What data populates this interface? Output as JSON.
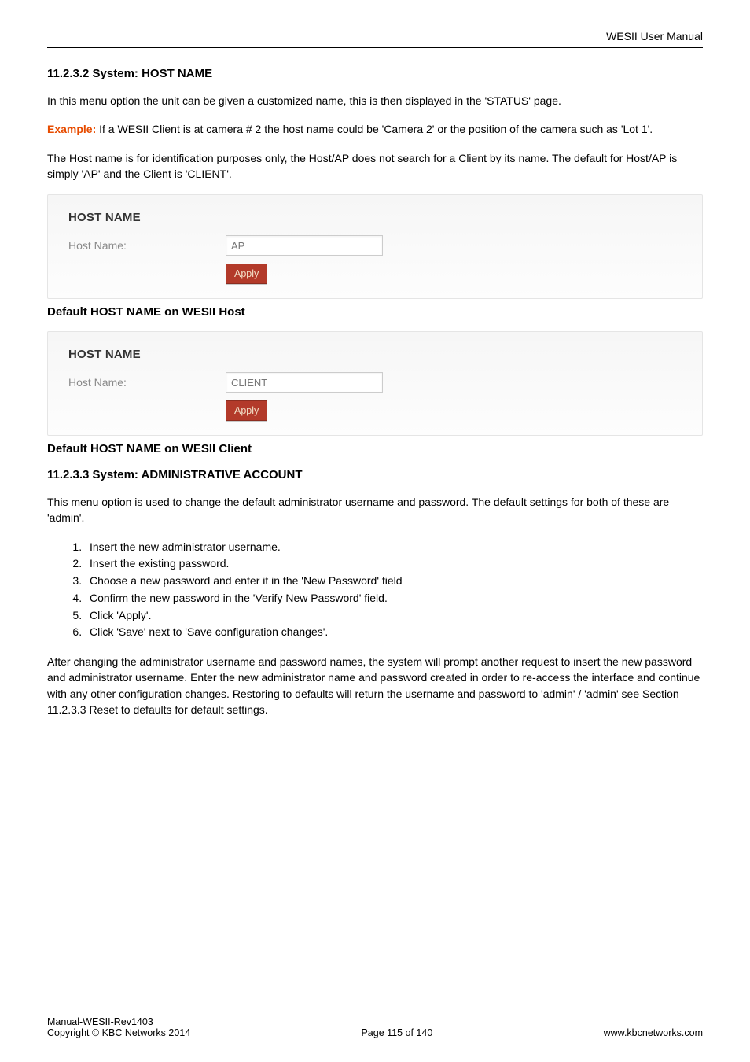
{
  "header": {
    "right": "WESII User Manual"
  },
  "s1": {
    "heading": "11.2.3.2 System: HOST NAME",
    "p1": "In this menu option the unit can be given a customized name, this is then displayed in the 'STATUS' page.",
    "example_label": "Example:",
    "example_text": " If a WESII Client is at camera # 2 the host name could be 'Camera 2' or the position of the camera such as 'Lot 1'.",
    "p3": "The Host name is for identification purposes only, the Host/AP does not search for a Client by its name. The default for Host/AP is simply 'AP' and the Client is 'CLIENT'."
  },
  "shot1": {
    "title": "HOST NAME",
    "label": "Host Name:",
    "value": "AP",
    "button": "Apply",
    "caption": "Default HOST NAME on WESII Host"
  },
  "shot2": {
    "title": "HOST NAME",
    "label": "Host Name:",
    "value": "CLIENT",
    "button": "Apply",
    "caption": "Default HOST NAME on WESII Client"
  },
  "s2": {
    "heading": "11.2.3.3 System: ADMINISTRATIVE ACCOUNT",
    "p1": "This menu option is used to change the default administrator username and password. The default settings for both of these are 'admin'.",
    "steps": [
      "Insert the new administrator username.",
      "Insert the existing password.",
      "Choose a new password and enter it in the 'New Password' field",
      "Confirm the new password in the 'Verify New Password' field.",
      "Click 'Apply'.",
      "Click 'Save' next to 'Save configuration changes'."
    ],
    "p2": "After changing the administrator username and password names, the system will prompt another request to insert the new password and administrator username. Enter the new administrator name and password created in order to re-access the interface and continue with any other configuration changes. Restoring to defaults will return the username and password to 'admin' / 'admin' see Section 11.2.3.3 Reset to defaults for default settings."
  },
  "footer": {
    "left1": "Manual-WESII-Rev1403",
    "left2": "Copyright © KBC Networks 2014",
    "center": "Page 115 of 140",
    "right": "www.kbcnetworks.com"
  }
}
